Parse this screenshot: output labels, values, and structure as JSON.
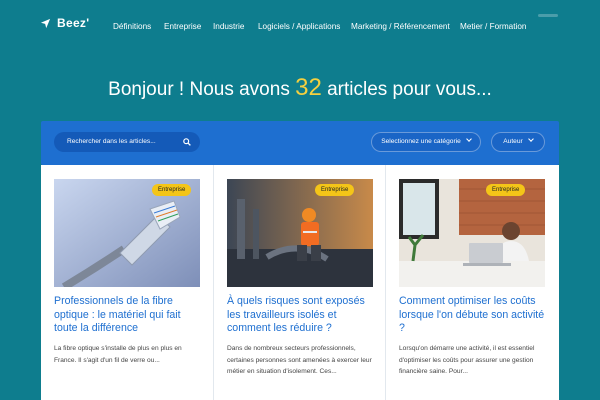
{
  "brand": {
    "name": "Beez'"
  },
  "nav": {
    "items": [
      "Définitions",
      "Entreprise",
      "Industrie",
      "Logiciels / Applications",
      "Marketing / Référencement",
      "Metier / Formation"
    ]
  },
  "hero": {
    "text_before": "Bonjour ! Nous avons",
    "count": "32",
    "text_after": "articles pour vous..."
  },
  "filters": {
    "search_placeholder": "Rechercher dans les articles...",
    "category_label": "Selectionnez une catégorie",
    "author_label": "Auteur"
  },
  "articles": [
    {
      "category": "Entreprise",
      "title": "Professionnels de la fibre optique : le matériel qui fait toute la différence",
      "excerpt": "La fibre optique s'installe de plus en plus en France. Il s'agit d'un fil de verre ou..."
    },
    {
      "category": "Entreprise",
      "title": "À quels risques sont exposés les travailleurs isolés et comment les réduire ?",
      "excerpt": "Dans de nombreux secteurs professionnels, certaines personnes sont amenées à exercer leur métier en situation d'isolement. Ces..."
    },
    {
      "category": "Entreprise",
      "title": "Comment optimiser les coûts lorsque l'on débute son activité ?",
      "excerpt": "Lorsqu'on démarre une activité, il est essentiel d'optimiser les coûts pour assurer une gestion financière saine. Pour..."
    }
  ],
  "colors": {
    "background": "#0e7d8e",
    "accent_blue": "#1e6fd0",
    "badge_yellow": "#f4c518",
    "count_yellow": "#f4d03f"
  }
}
